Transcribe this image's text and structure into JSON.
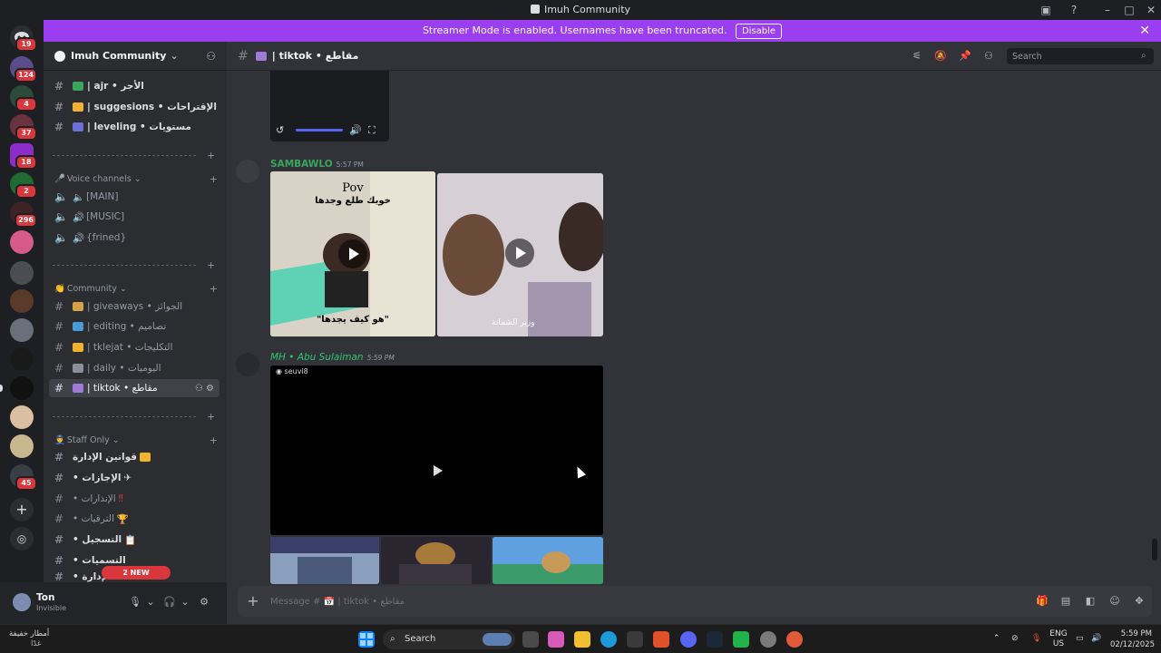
{
  "window": {
    "title": "Imuh Community"
  },
  "banner": {
    "text": "Streamer Mode is enabled. Usernames have been truncated.",
    "button": "Disable"
  },
  "rail": {
    "badges": [
      "19",
      "124",
      "4",
      "37",
      "18",
      "2",
      "296",
      "45"
    ]
  },
  "guild": {
    "name": "Imuh Community"
  },
  "channels": {
    "top": [
      {
        "name": "| ajr • الأجر"
      },
      {
        "name": "| suggesions • الإقتراحات"
      },
      {
        "name": "| leveling • مستويات"
      }
    ],
    "voice_category": "Voice channels",
    "voice": [
      {
        "name": "[MAIN]"
      },
      {
        "name": "[MUSIC]"
      },
      {
        "name": "{frined}"
      }
    ],
    "community_category": "Community",
    "community": [
      {
        "name": "| giveaways • الجوائز"
      },
      {
        "name": "| editing • تصاميم"
      },
      {
        "name": "| tklejat • التكليجات"
      },
      {
        "name": "| daily • اليوميات"
      },
      {
        "name": "| tiktok • مقاطع"
      }
    ],
    "staff_category": "Staff Only",
    "staff": [
      {
        "name": "قوانين الإدارة"
      },
      {
        "name": "• الإجازات"
      },
      {
        "name": "• الإنذارات"
      },
      {
        "name": "• الترقيات"
      },
      {
        "name": "• التسجيل"
      },
      {
        "name": "• التسميات"
      },
      {
        "name": "• الإدارة"
      }
    ],
    "new_mentions": "2 NEW MENTIONS"
  },
  "user": {
    "name": "Ton",
    "status": "Invisible"
  },
  "header": {
    "channel": "| tiktok • مقاطع",
    "search_placeholder": "Search"
  },
  "messages": [
    {
      "author": "SAMBAWLO",
      "time": "5:57 PM",
      "color": "#3ba55d",
      "overlay_top": "Pov",
      "overlay_ar": "خويك طلع وجدها",
      "overlay_bottom": "\"هو كيف يجدها\"",
      "overlay_right": "وزير الشماتة"
    },
    {
      "author": "MH • Abu Sulaiman",
      "time": "5:59 PM",
      "color": "#2dc770",
      "video_user": "seuvi8"
    }
  ],
  "composer": {
    "placeholder": "Message # 📅 | tiktok • مقاطع"
  },
  "taskbar": {
    "weather": "أمطار خفيفة",
    "weather_sub": "غدًا",
    "search": "Search",
    "lang_top": "ENG",
    "lang_bottom": "US",
    "time": "5:59 PM",
    "date": "02/12/2025"
  }
}
